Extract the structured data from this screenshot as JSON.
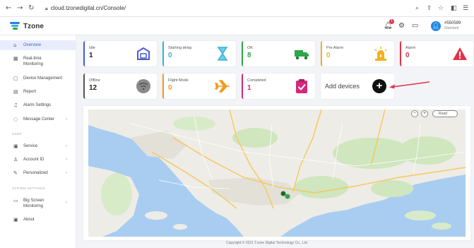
{
  "browser": {
    "url": "cloud.tzonedigital.cn/Console/"
  },
  "header": {
    "app_name": "Tzone",
    "notification_count": "1",
    "user_name": "#550599",
    "user_role": "Standard"
  },
  "sidebar": {
    "items": [
      {
        "label": "Overview",
        "icon": "home-icon"
      },
      {
        "label": "Real-time",
        "label2": "Monitoring",
        "icon": "monitor-icon"
      },
      {
        "label": "Device Management",
        "icon": "device-icon"
      },
      {
        "label": "Report",
        "icon": "report-icon"
      },
      {
        "label": "Alarm Settings",
        "icon": "bell-icon"
      },
      {
        "label": "Message Center",
        "icon": "message-icon"
      },
      {
        "label": "Service",
        "icon": "service-icon"
      },
      {
        "label": "Account ID",
        "icon": "user-icon"
      },
      {
        "label": "Personalized",
        "icon": "brush-icon"
      },
      {
        "label": "Big Screen",
        "label2": "Monitoring",
        "icon": "screen-icon"
      },
      {
        "label": "About",
        "icon": "info-icon"
      }
    ],
    "sections": [
      "USER",
      "SYSTEM SETTINGS"
    ]
  },
  "cards": [
    {
      "label": "Idle",
      "value": "1",
      "color": "#4a5bd1",
      "icon": "box-icon"
    },
    {
      "label": "Starting delay",
      "value": "0",
      "color": "#35b3d8",
      "icon": "hourglass-icon"
    },
    {
      "label": "OK",
      "value": "8",
      "color": "#2fa64a",
      "icon": "truck-icon"
    },
    {
      "label": "Pre Alarm",
      "value": "0",
      "color": "#f3b21b",
      "icon": "warning-light-icon"
    },
    {
      "label": "Alarm",
      "value": "0",
      "color": "#e0334a",
      "icon": "alarm-triangle-icon"
    },
    {
      "label": "Offline",
      "value": "12",
      "color": "#555555",
      "icon": "offline-icon"
    },
    {
      "label": "Flight Mode",
      "value": "0",
      "color": "#f39a1b",
      "icon": "plane-icon"
    },
    {
      "label": "Completed",
      "value": "1",
      "color": "#d6287a",
      "icon": "clipboard-check-icon"
    }
  ],
  "add_devices": {
    "label": "Add devices"
  },
  "map": {
    "select_label": "Road"
  },
  "footer": {
    "text": "Copyright © 2021 Tzone Digital Technology Co., Ltd"
  }
}
